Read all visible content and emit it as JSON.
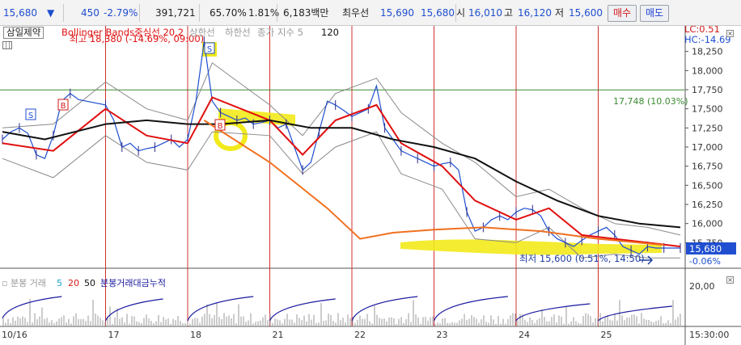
{
  "topbar": {
    "price": "15,680",
    "change_arrow": "▼",
    "change": "450",
    "change_pct": "-2.79%",
    "volume": "391,721",
    "vol_ratio": "65.70%",
    "turnover_ratio": "1.81%",
    "amount": "6,183백만",
    "best_label": "최우선",
    "bid": "15,690",
    "ask": "15,680",
    "open_label": "시",
    "open": "16,010",
    "high_label": "고",
    "high": "16,120",
    "low_label": "저",
    "low": "15,600",
    "buy_label": "매수",
    "sell_label": "매도"
  },
  "legend": {
    "symbol": "삼일제약",
    "bb_label": "Bollinger Bands중심선 20,2",
    "upper_label": "상한선",
    "lower_label": "하한선",
    "close_label": "종가 지수 5",
    "ma_value": "120",
    "high_annotation": "최고 18,380 (-14.69%, 09:00)",
    "low_annotation": "최저 15,600 (0.51%, 14:50)",
    "hline_annotation": "17,748 (10.03%)",
    "lc_label": "LC:0.51",
    "hc_label": "HC:-14.69",
    "current_price_tag": "15,680",
    "current_pct_tag": "-0.06%",
    "volume_legend": {
      "name": "분봉 거래",
      "p1": "5",
      "p2": "20",
      "p3": "50",
      "cum": "분봉거래대금누적"
    },
    "volume_axis_label": "20,00",
    "signal_S": "S",
    "signal_B": "B"
  },
  "colors": {
    "price": "#1f4fd0",
    "ma_red": "#e01010",
    "ma_black": "#111111",
    "bb_band": "#8a8a8a",
    "orange_line": "#f07020",
    "highlight": "#f2ea1a",
    "session_line": "#d03030",
    "hline": "#3a8a30",
    "price_tag_bg": "#1f4fd0"
  },
  "chart_data": {
    "type": "line",
    "title": "",
    "sessions": [
      "10/16",
      "17",
      "18",
      "21",
      "22",
      "23",
      "24",
      "25"
    ],
    "time_label": "15:30:00",
    "ylim": [
      15500,
      18500
    ],
    "yticks": [
      15750,
      16000,
      16250,
      16500,
      16750,
      17000,
      17250,
      17500,
      17750,
      18000,
      18250
    ],
    "ytick_labels": [
      "15,750",
      "16,000",
      "16,250",
      "16,500",
      "16,750",
      "17,000",
      "17,250",
      "17,500",
      "17,750",
      "18,000",
      "18,250"
    ],
    "hline_value": 17748,
    "price_x": [
      0,
      0.1,
      0.2,
      0.3,
      0.4,
      0.5,
      0.6,
      0.7,
      0.8,
      0.9,
      1.0,
      1.1,
      1.2,
      1.3,
      1.4,
      1.5,
      1.6,
      1.7,
      1.8,
      1.9,
      2.0,
      2.1,
      2.2,
      2.3,
      2.4,
      2.5,
      2.6,
      2.7,
      2.8,
      2.9,
      3.0,
      3.1,
      3.2,
      3.3,
      3.4,
      3.5,
      3.6,
      3.7,
      3.8,
      3.9,
      4.0,
      4.1,
      4.2,
      4.3,
      4.4,
      4.5,
      4.6,
      4.7,
      4.8,
      4.9,
      5.0,
      5.1,
      5.2,
      5.3,
      5.4,
      5.5,
      5.6,
      5.7,
      5.8,
      5.9,
      6.0,
      6.1,
      6.2,
      6.3,
      6.4,
      6.5,
      6.6,
      6.7,
      6.8,
      6.9,
      7.0,
      7.1,
      7.2,
      7.3,
      7.4,
      7.5,
      7.6,
      7.7,
      7.8,
      7.9,
      8.0
    ],
    "price": [
      17100,
      17200,
      17250,
      17180,
      16900,
      16850,
      17150,
      17600,
      17700,
      17620,
      17550,
      17350,
      17000,
      17050,
      16950,
      16980,
      17000,
      17050,
      17100,
      17000,
      17100,
      17600,
      18380,
      17600,
      17450,
      17400,
      17350,
      17380,
      17300,
      17320,
      17350,
      17250,
      17300,
      17000,
      16700,
      16800,
      17200,
      17600,
      17550,
      17480,
      17400,
      17450,
      17500,
      17800,
      17250,
      17100,
      16950,
      16900,
      16850,
      16800,
      16750,
      16780,
      16800,
      16700,
      16150,
      15900,
      15950,
      16050,
      16100,
      16050,
      16150,
      16200,
      16180,
      16100,
      15900,
      15800,
      15750,
      15700,
      15780,
      15850,
      15900,
      15950,
      15850,
      15700,
      15650,
      15600,
      15700,
      15680,
      15680,
      15680,
      15680
    ],
    "series": [
      {
        "name": "Bollinger Bands중심선 20,2",
        "points": [
          [
            0,
            17050
          ],
          [
            0.6,
            16950
          ],
          [
            1.0,
            17500
          ],
          [
            1.5,
            17150
          ],
          [
            2.0,
            17050
          ],
          [
            2.3,
            17650
          ],
          [
            3.0,
            17350
          ],
          [
            3.4,
            16900
          ],
          [
            3.8,
            17350
          ],
          [
            4.3,
            17550
          ],
          [
            4.6,
            17050
          ],
          [
            5.1,
            16750
          ],
          [
            5.5,
            16300
          ],
          [
            6.0,
            16050
          ],
          [
            6.4,
            16200
          ],
          [
            6.8,
            15850
          ],
          [
            7.2,
            15800
          ],
          [
            7.6,
            15750
          ],
          [
            8.0,
            15700
          ]
        ]
      },
      {
        "name": "120",
        "points": [
          [
            0,
            17200
          ],
          [
            0.5,
            17100
          ],
          [
            1.0,
            17300
          ],
          [
            1.5,
            17350
          ],
          [
            2.0,
            17300
          ],
          [
            2.4,
            17300
          ],
          [
            3.0,
            17350
          ],
          [
            3.5,
            17250
          ],
          [
            4.0,
            17250
          ],
          [
            4.5,
            17100
          ],
          [
            5.0,
            17000
          ],
          [
            5.5,
            16850
          ],
          [
            6.0,
            16550
          ],
          [
            6.5,
            16300
          ],
          [
            7.0,
            16100
          ],
          [
            7.5,
            16000
          ],
          [
            8.0,
            15950
          ]
        ]
      },
      {
        "name": "상한선",
        "points": [
          [
            0,
            17250
          ],
          [
            0.6,
            17300
          ],
          [
            1.0,
            17850
          ],
          [
            1.5,
            17500
          ],
          [
            2.0,
            17350
          ],
          [
            2.3,
            18100
          ],
          [
            3.0,
            17550
          ],
          [
            3.4,
            17150
          ],
          [
            3.8,
            17700
          ],
          [
            4.3,
            17900
          ],
          [
            4.6,
            17450
          ],
          [
            5.1,
            17050
          ],
          [
            5.5,
            16800
          ],
          [
            6.0,
            16350
          ],
          [
            6.4,
            16450
          ],
          [
            6.8,
            16200
          ],
          [
            7.2,
            16000
          ],
          [
            7.6,
            15950
          ],
          [
            8.0,
            15850
          ]
        ]
      },
      {
        "name": "하한선",
        "points": [
          [
            0,
            16850
          ],
          [
            0.6,
            16600
          ],
          [
            1.0,
            17150
          ],
          [
            1.5,
            16800
          ],
          [
            2.0,
            16700
          ],
          [
            2.3,
            17200
          ],
          [
            3.0,
            17150
          ],
          [
            3.4,
            16650
          ],
          [
            3.8,
            17000
          ],
          [
            4.3,
            17200
          ],
          [
            4.6,
            16650
          ],
          [
            5.1,
            16450
          ],
          [
            5.5,
            15800
          ],
          [
            6.0,
            15750
          ],
          [
            6.4,
            15950
          ],
          [
            6.8,
            15550
          ],
          [
            7.2,
            15600
          ],
          [
            7.6,
            15550
          ],
          [
            8.0,
            15550
          ]
        ]
      },
      {
        "name": "종가 지수 5",
        "points": [
          [
            2.2,
            17350
          ],
          [
            3.0,
            16800
          ],
          [
            3.7,
            16200
          ],
          [
            4.1,
            15800
          ],
          [
            4.5,
            15880
          ],
          [
            5.0,
            15920
          ],
          [
            5.6,
            15950
          ],
          [
            6.3,
            15900
          ],
          [
            7.0,
            15800
          ],
          [
            7.8,
            15720
          ]
        ]
      }
    ],
    "volume_cumulative": [
      [
        0,
        0.1
      ],
      [
        0.7,
        0.55
      ],
      [
        1.0,
        0.05
      ],
      [
        1.7,
        0.5
      ],
      [
        2.0,
        0.05
      ],
      [
        2.8,
        0.55
      ],
      [
        3.0,
        0.05
      ],
      [
        3.8,
        0.5
      ],
      [
        4.0,
        0.05
      ],
      [
        4.8,
        0.55
      ],
      [
        5.0,
        0.05
      ],
      [
        5.9,
        0.55
      ],
      [
        6.0,
        0.05
      ],
      [
        6.9,
        0.4
      ],
      [
        7.0,
        0.05
      ],
      [
        7.9,
        0.35
      ]
    ]
  }
}
